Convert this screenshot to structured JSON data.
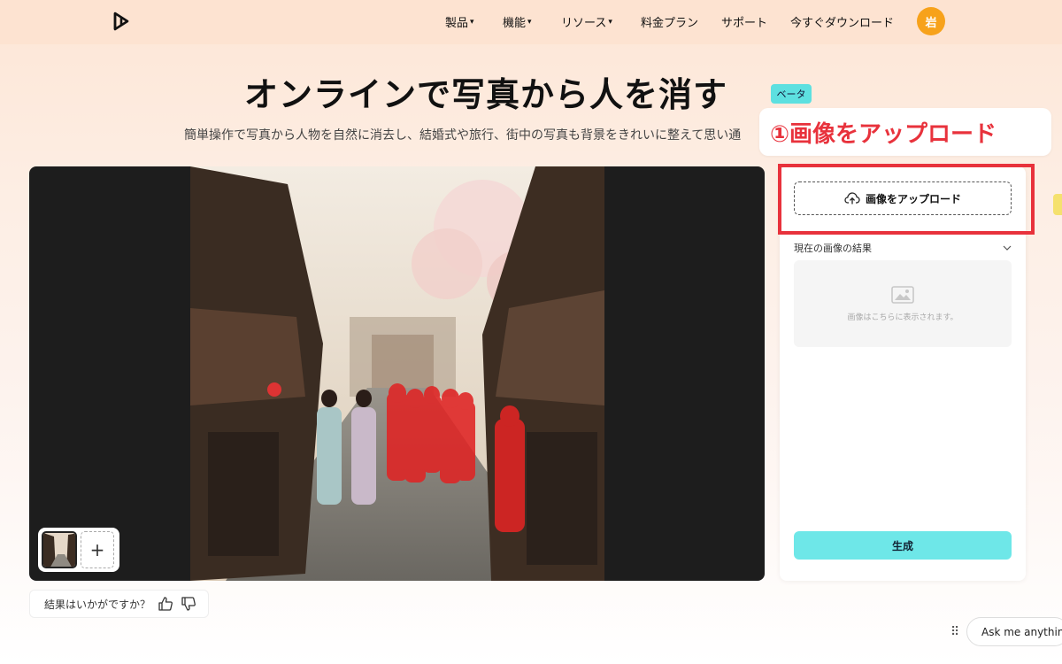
{
  "nav": {
    "items": [
      {
        "label": "製品",
        "caret": "▾"
      },
      {
        "label": "機能",
        "caret": "▾"
      },
      {
        "label": "リソース",
        "caret": "▾"
      },
      {
        "label": "料金プラン",
        "caret": ""
      },
      {
        "label": "サポート",
        "caret": ""
      },
      {
        "label": "今すぐダウンロード",
        "caret": ""
      }
    ],
    "avatar_text": "岩"
  },
  "hero": {
    "title": "オンラインで写真から人を消す",
    "badge": "ベータ",
    "subtitle": "簡単操作で写真から人物を自然に消去し、結婚式や旅行、街中の写真も背景をきれいに整えて思い通"
  },
  "callout": {
    "text": "①画像をアップロード"
  },
  "canvas": {
    "add_label": "+"
  },
  "feedback": {
    "question": "結果はいかがですか？"
  },
  "panel": {
    "upload_label": "画像をアップロード",
    "result_header": "現在の画像の結果",
    "preview_placeholder": "画像はこちらに表示されます。",
    "generate_label": "生成"
  },
  "assistant": {
    "label": "Ask me anything"
  },
  "colors": {
    "accent_cyan": "#6ee7e8",
    "highlight_red": "#e8323c",
    "avatar_orange": "#f7a21b"
  }
}
